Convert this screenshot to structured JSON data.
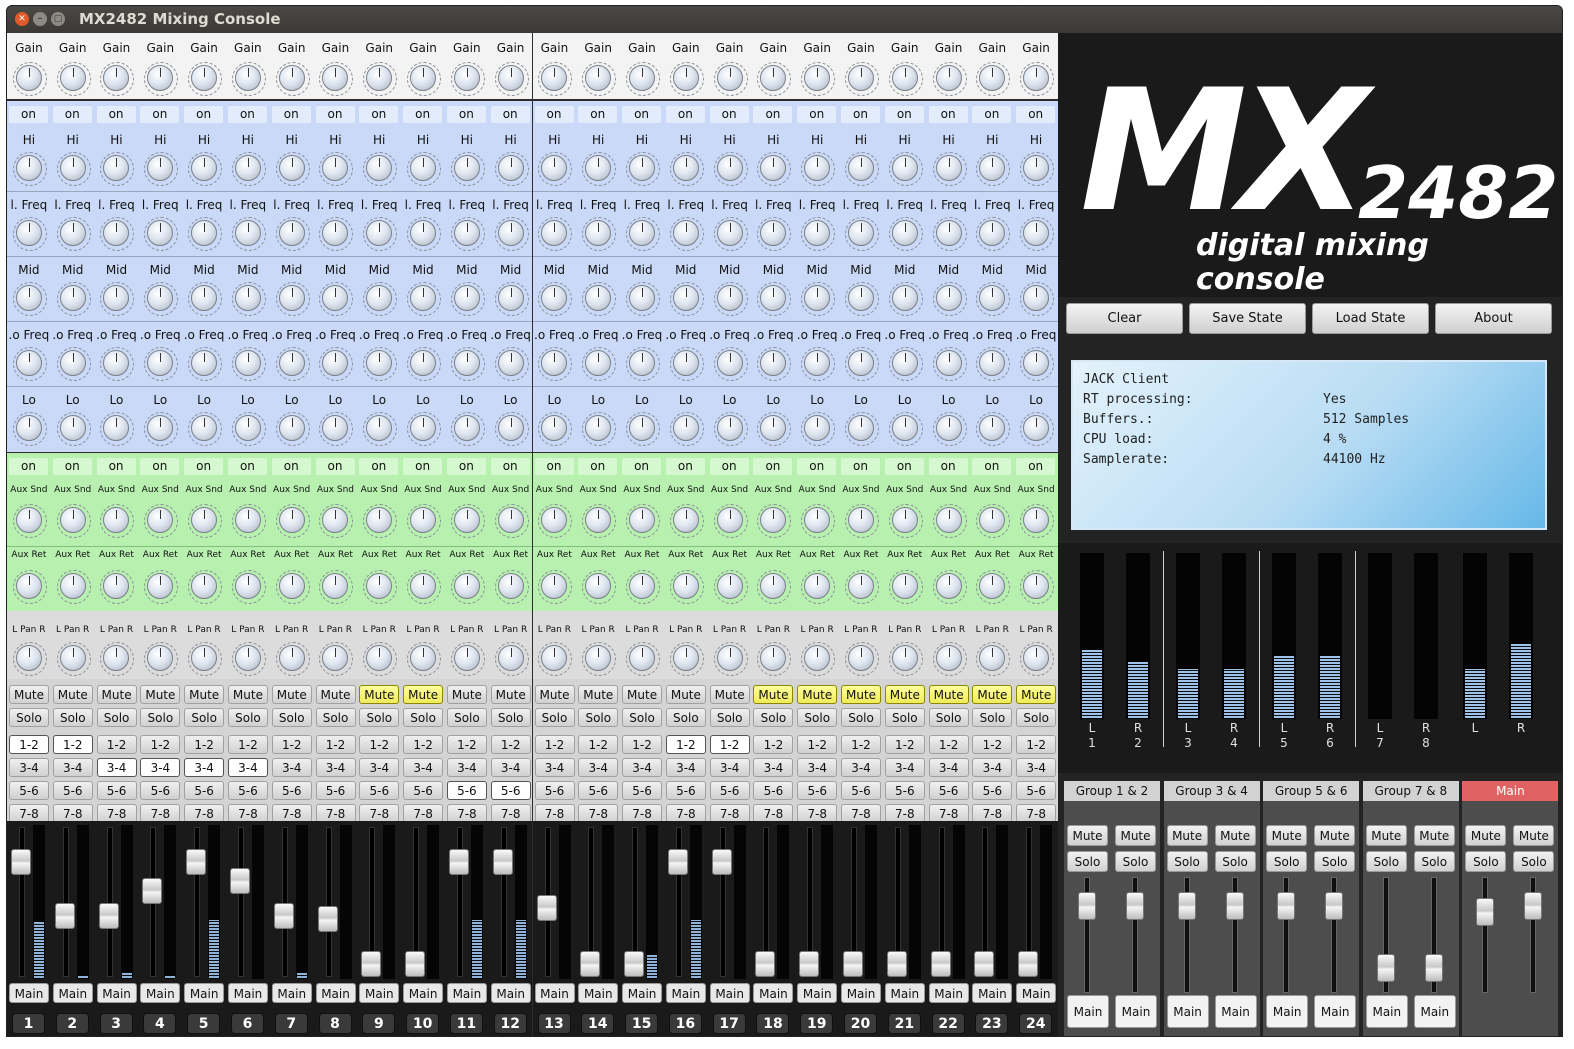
{
  "window": {
    "title": "MX2482 Mixing Console"
  },
  "strip_labels": {
    "gain": "Gain",
    "eq_on": "on",
    "hi": "Hi",
    "hi_freq": "l. Freq",
    "mid": "Mid",
    "mid_freq": ".o Freq",
    "lo": "Lo",
    "aux_on": "on",
    "aux_send": "Aux Snd",
    "aux_ret": "Aux Ret",
    "pan": "L Pan R",
    "mute": "Mute",
    "solo": "Solo",
    "g12": "1-2",
    "g34": "3-4",
    "g56": "5-6",
    "g78": "7-8",
    "main": "Main"
  },
  "channels": [
    {
      "num": "1",
      "mute": false,
      "g12": true,
      "g34": false,
      "g56": false,
      "fader": 0.83,
      "meter": 0.37
    },
    {
      "num": "2",
      "mute": false,
      "g12": true,
      "g34": false,
      "g56": false,
      "fader": 0.44,
      "meter": 0.01
    },
    {
      "num": "3",
      "mute": false,
      "g12": false,
      "g34": true,
      "g56": false,
      "fader": 0.44,
      "meter": 0.04
    },
    {
      "num": "4",
      "mute": false,
      "g12": false,
      "g34": true,
      "g56": false,
      "fader": 0.62,
      "meter": 0.01
    },
    {
      "num": "5",
      "mute": false,
      "g12": false,
      "g34": true,
      "g56": false,
      "fader": 0.83,
      "meter": 0.38
    },
    {
      "num": "6",
      "mute": false,
      "g12": false,
      "g34": true,
      "g56": false,
      "fader": 0.69,
      "meter": 0.0
    },
    {
      "num": "7",
      "mute": false,
      "g12": false,
      "g34": false,
      "g56": false,
      "fader": 0.44,
      "meter": 0.04
    },
    {
      "num": "8",
      "mute": false,
      "g12": false,
      "g34": false,
      "g56": false,
      "fader": 0.42,
      "meter": 0.0
    },
    {
      "num": "9",
      "mute": true,
      "g12": false,
      "g34": false,
      "g56": false,
      "fader": 0.1,
      "meter": 0.0
    },
    {
      "num": "10",
      "mute": true,
      "g12": false,
      "g34": false,
      "g56": false,
      "fader": 0.1,
      "meter": 0.0
    },
    {
      "num": "11",
      "mute": false,
      "g12": false,
      "g34": false,
      "g56": true,
      "fader": 0.83,
      "meter": 0.38
    },
    {
      "num": "12",
      "mute": false,
      "g12": false,
      "g34": false,
      "g56": true,
      "fader": 0.83,
      "meter": 0.38
    },
    {
      "num": "13",
      "mute": false,
      "g12": false,
      "g34": false,
      "g56": false,
      "fader": 0.5,
      "meter": 0.0
    },
    {
      "num": "14",
      "mute": false,
      "g12": false,
      "g34": false,
      "g56": false,
      "fader": 0.1,
      "meter": 0.0
    },
    {
      "num": "15",
      "mute": false,
      "g12": false,
      "g34": false,
      "g56": false,
      "fader": 0.1,
      "meter": 0.15
    },
    {
      "num": "16",
      "mute": false,
      "g12": true,
      "g34": false,
      "g56": false,
      "fader": 0.83,
      "meter": 0.38
    },
    {
      "num": "17",
      "mute": false,
      "g12": true,
      "g34": false,
      "g56": false,
      "fader": 0.83,
      "meter": 0.0
    },
    {
      "num": "18",
      "mute": true,
      "g12": false,
      "g34": false,
      "g56": false,
      "fader": 0.1,
      "meter": 0.0
    },
    {
      "num": "19",
      "mute": true,
      "g12": false,
      "g34": false,
      "g56": false,
      "fader": 0.1,
      "meter": 0.0
    },
    {
      "num": "20",
      "mute": true,
      "g12": false,
      "g34": false,
      "g56": false,
      "fader": 0.1,
      "meter": 0.0
    },
    {
      "num": "21",
      "mute": true,
      "g12": false,
      "g34": false,
      "g56": false,
      "fader": 0.1,
      "meter": 0.0
    },
    {
      "num": "22",
      "mute": true,
      "g12": false,
      "g34": false,
      "g56": false,
      "fader": 0.1,
      "meter": 0.0
    },
    {
      "num": "23",
      "mute": true,
      "g12": false,
      "g34": false,
      "g56": false,
      "fader": 0.1,
      "meter": 0.0
    },
    {
      "num": "24",
      "mute": true,
      "g12": false,
      "g34": false,
      "g56": false,
      "fader": 0.1,
      "meter": 0.0
    }
  ],
  "logo": {
    "brand": "MX",
    "model": "2482",
    "subtitle": "digital mixing console"
  },
  "toolbar": {
    "clear": "Clear",
    "save": "Save State",
    "load": "Load State",
    "about": "About"
  },
  "info": {
    "title": "JACK Client",
    "rows": [
      {
        "k": "RT processing:",
        "v": "Yes"
      },
      {
        "k": "Buffers.:",
        "v": "512 Samples"
      },
      {
        "k": "CPU load:",
        "v": "4 %"
      },
      {
        "k": "Samplerate:",
        "v": "44100 Hz"
      }
    ]
  },
  "meters": [
    {
      "lr": "L",
      "n": "1",
      "level": 0.42
    },
    {
      "lr": "R",
      "n": "2",
      "level": 0.34
    },
    {
      "lr": "L",
      "n": "3",
      "level": 0.3
    },
    {
      "lr": "R",
      "n": "4",
      "level": 0.3
    },
    {
      "lr": "L",
      "n": "5",
      "level": 0.38
    },
    {
      "lr": "R",
      "n": "6",
      "level": 0.38
    },
    {
      "lr": "L",
      "n": "7",
      "level": 0.0
    },
    {
      "lr": "R",
      "n": "8",
      "level": 0.0
    },
    {
      "lr": "L",
      "n": "",
      "level": 0.3
    },
    {
      "lr": "R",
      "n": "",
      "level": 0.45
    }
  ],
  "groups": [
    {
      "name": "Group 1 & 2",
      "mute": "Mute",
      "solo": "Solo",
      "main": "Main",
      "faders": [
        0.85,
        0.85
      ],
      "is_main": false
    },
    {
      "name": "Group 3 & 4",
      "mute": "Mute",
      "solo": "Solo",
      "main": "Main",
      "faders": [
        0.85,
        0.85
      ],
      "is_main": false
    },
    {
      "name": "Group 5 & 6",
      "mute": "Mute",
      "solo": "Solo",
      "main": "Main",
      "faders": [
        0.85,
        0.85
      ],
      "is_main": false
    },
    {
      "name": "Group 7 & 8",
      "mute": "Mute",
      "solo": "Solo",
      "main": "Main",
      "faders": [
        0.15,
        0.15
      ],
      "is_main": false
    },
    {
      "name": "Main",
      "mute": "Mute",
      "solo": "Solo",
      "main": "",
      "faders": [
        0.78,
        0.85
      ],
      "is_main": true
    }
  ],
  "colors": {
    "mute_active": "#f6f27a",
    "eq_bg": "#c9d9f7",
    "aux_bg": "#b8f0b0",
    "main_header": "#e06262"
  }
}
